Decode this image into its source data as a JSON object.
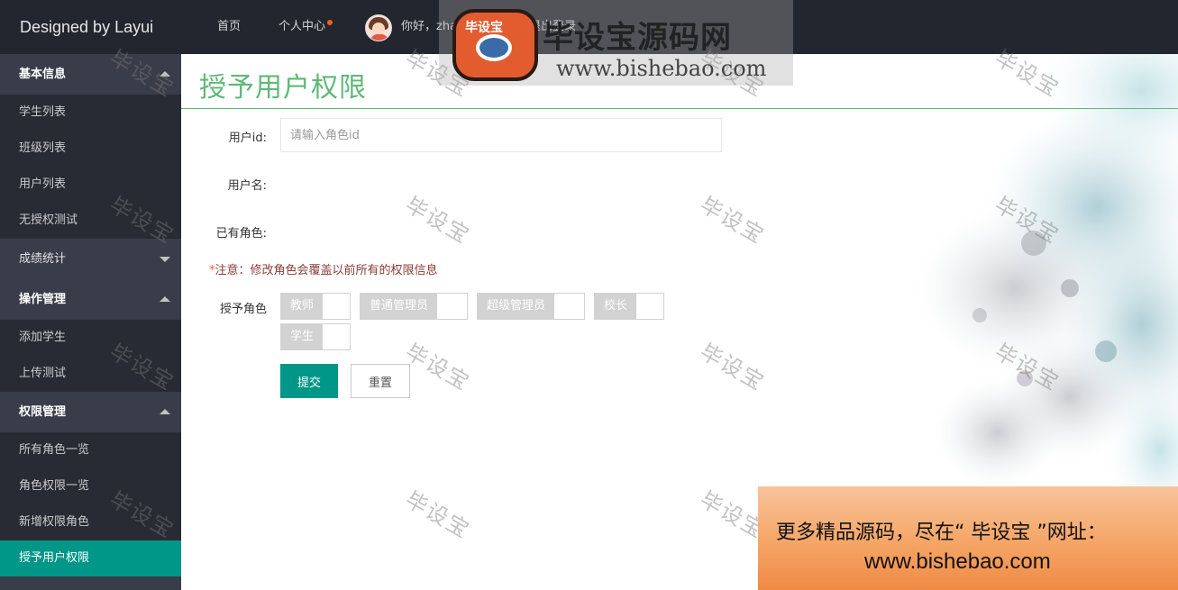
{
  "app": {
    "logo": "Designed by Layui"
  },
  "sidebar": {
    "groups": [
      {
        "label": "基本信息",
        "expanded": true,
        "items": [
          "学生列表",
          "班级列表",
          "用户列表",
          "无授权测试"
        ]
      },
      {
        "label": "成绩统计",
        "expanded": false,
        "items": []
      },
      {
        "label": "操作管理",
        "expanded": true,
        "items": [
          "添加学生",
          "上传测试"
        ]
      },
      {
        "label": "权限管理",
        "expanded": true,
        "items": [
          "所有角色一览",
          "角色权限一览",
          "新增权限角色",
          "授予用户权限"
        ]
      }
    ],
    "active_item": "授予用户权限"
  },
  "header": {
    "home": "首页",
    "profile": "个人中心",
    "greeting": "你好，zhangsan",
    "logout": "退出登录"
  },
  "page": {
    "title": "授予用户权限",
    "user_id_label": "用户id:",
    "user_id_placeholder": "请输入角色id",
    "user_name_label": "用户名:",
    "existing_roles_label": "已有角色:",
    "note_star": "*",
    "note_text": "注意：修改角色会覆盖以前所有的权限信息",
    "grant_roles_label": "授予角色",
    "roles": [
      "教师",
      "普通管理员",
      "超级管理员",
      "校长",
      "学生"
    ],
    "submit": "提交",
    "reset": "重置"
  },
  "watermark": {
    "text": "毕设宝",
    "banner_logo": "毕设宝",
    "banner_title": "毕设宝源码网",
    "banner_url": "www.bishebao.com",
    "ad_line1": "更多精品源码，尽在“ 毕设宝 ”网址：",
    "ad_line2": "www.bishebao.com"
  },
  "colors": {
    "primary": "#009688",
    "title_green": "#5fb878",
    "sidebar_bg": "#393d49",
    "header_bg": "#23262e",
    "badge": "#ff5722"
  }
}
